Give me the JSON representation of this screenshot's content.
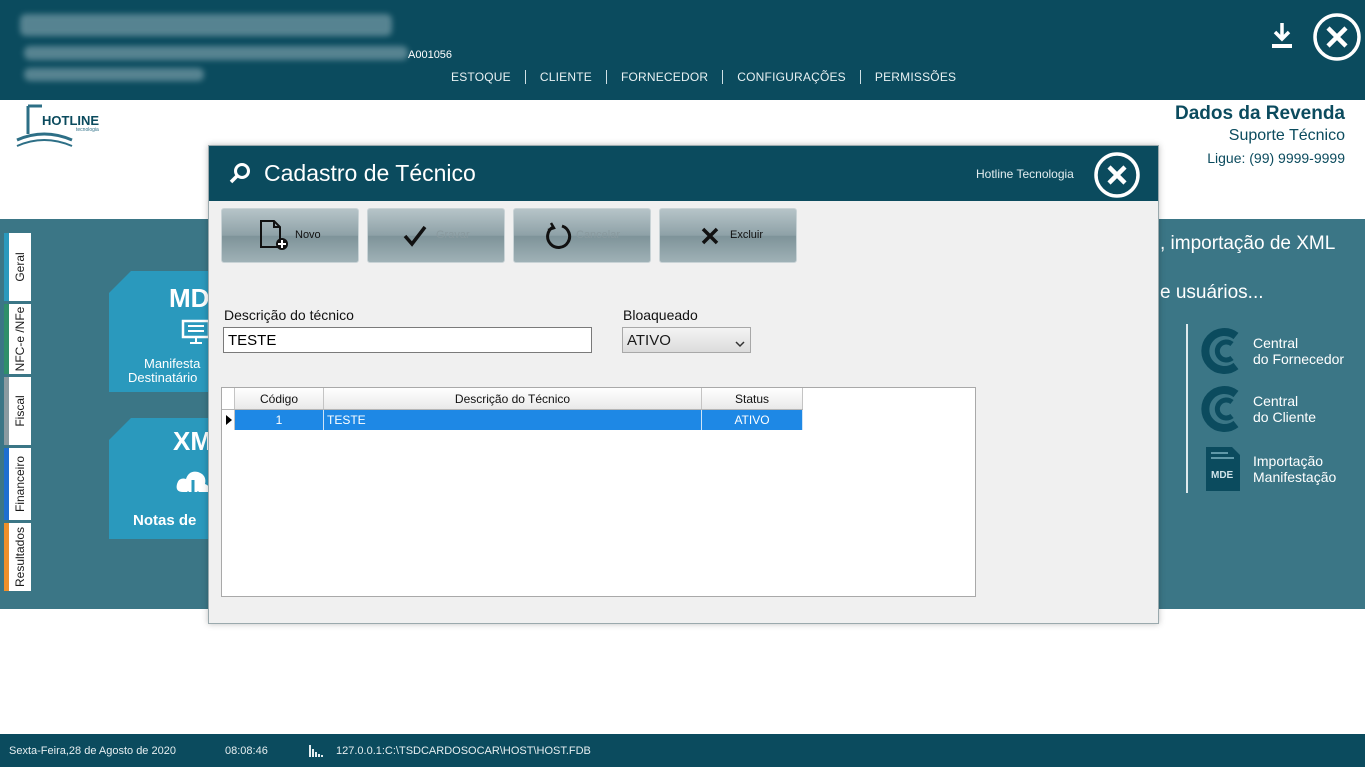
{
  "topbar": {
    "company_code": "A001056",
    "nav": [
      "ESTOQUE",
      "CLIENTE",
      "FORNECEDOR",
      "CONFIGURAÇÕES",
      "PERMISSÕES"
    ]
  },
  "logo": {
    "brand": "HOTLINE",
    "tagline": "tecnologia"
  },
  "reseller": {
    "title": "Dados da Revenda",
    "support": "Suporte Técnico",
    "phone": "Ligue: (99) 9999-9999"
  },
  "sidetabs": [
    "Geral",
    "NFC-e /NFe",
    "Fiscal",
    "Financeiro",
    "Resultados"
  ],
  "tiles": {
    "mde": {
      "title": "MD",
      "line1": "Manifesta",
      "line2": "Destinatário"
    },
    "xml": {
      "title": "XM",
      "line1": "Notas de"
    }
  },
  "background_text": {
    "line1": ", importação de XML",
    "line2": "e usuários..."
  },
  "right_links": [
    {
      "line1": "Central",
      "line2": "do Fornecedor",
      "icon": "central-logo-icon"
    },
    {
      "line1": "Central",
      "line2": "do Cliente",
      "icon": "central-logo-icon"
    },
    {
      "line1": "Importação",
      "line2": "Manifestação",
      "icon": "mde-document-icon",
      "badge": "MDE"
    }
  ],
  "statusbar": {
    "date": "Sexta-Feira,28 de Agosto de 2020",
    "time": "08:08:46",
    "db_path": "127.0.0.1:C:\\TSDCARDOSOCAR\\HOST\\HOST.FDB"
  },
  "modal": {
    "title": "Cadastro de Técnico",
    "company": "Hotline Tecnologia",
    "toolbar": {
      "novo": "Novo",
      "gravar": "Gravar",
      "cancelar": "Cancelar",
      "excluir": "Excluir"
    },
    "form": {
      "desc_label": "Descrição do técnico",
      "desc_value": "TESTE",
      "blocked_label": "Bloaqueado",
      "blocked_value": "ATIVO"
    },
    "grid": {
      "columns": [
        "Código",
        "Descrição do Técnico",
        "Status"
      ],
      "rows": [
        {
          "codigo": "1",
          "descricao": "TESTE",
          "status": "ATIVO"
        }
      ]
    }
  },
  "colors": {
    "primary": "#0b4b5e",
    "band": "#3b7686",
    "tile": "#2a99bd",
    "selection": "#1e88e5"
  }
}
